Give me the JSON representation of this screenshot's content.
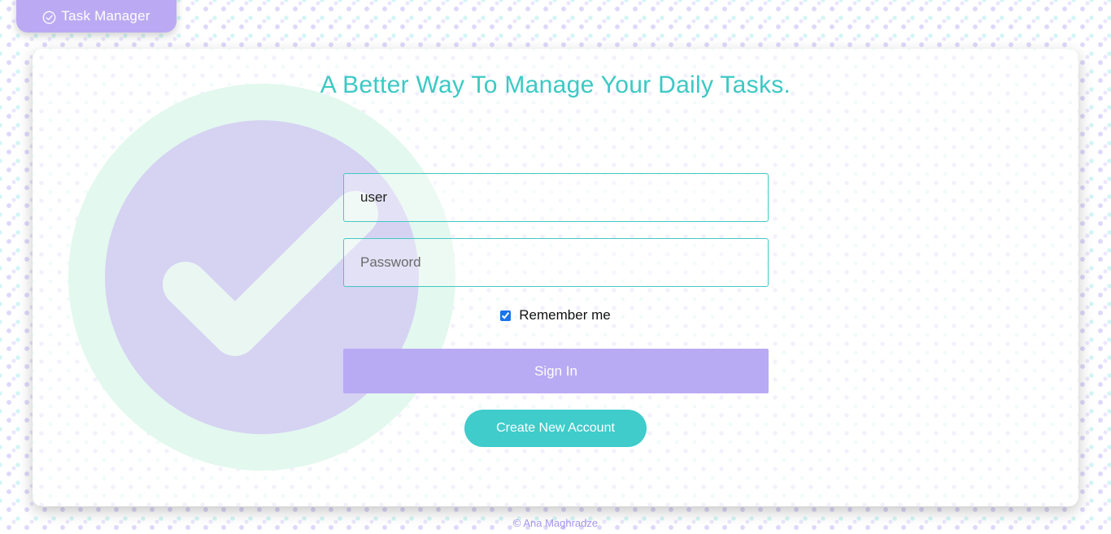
{
  "brand": {
    "label": "Task Manager",
    "icon": "check-circle-icon"
  },
  "card": {
    "headline": "A Better Way To Manage Your Daily Tasks.",
    "illustration_icon": "checkmark-circle-icon"
  },
  "form": {
    "username_value": "user",
    "password_placeholder": "Password",
    "remember_label": "Remember me",
    "remember_checked": true,
    "signin_label": "Sign In",
    "create_account_label": "Create New Account"
  },
  "footer": {
    "credit": "© Ana Maghradze"
  },
  "colors": {
    "accent_purple": "#b9aaf4",
    "accent_teal": "#3fcccb",
    "headline_teal": "#3cc9c4"
  }
}
